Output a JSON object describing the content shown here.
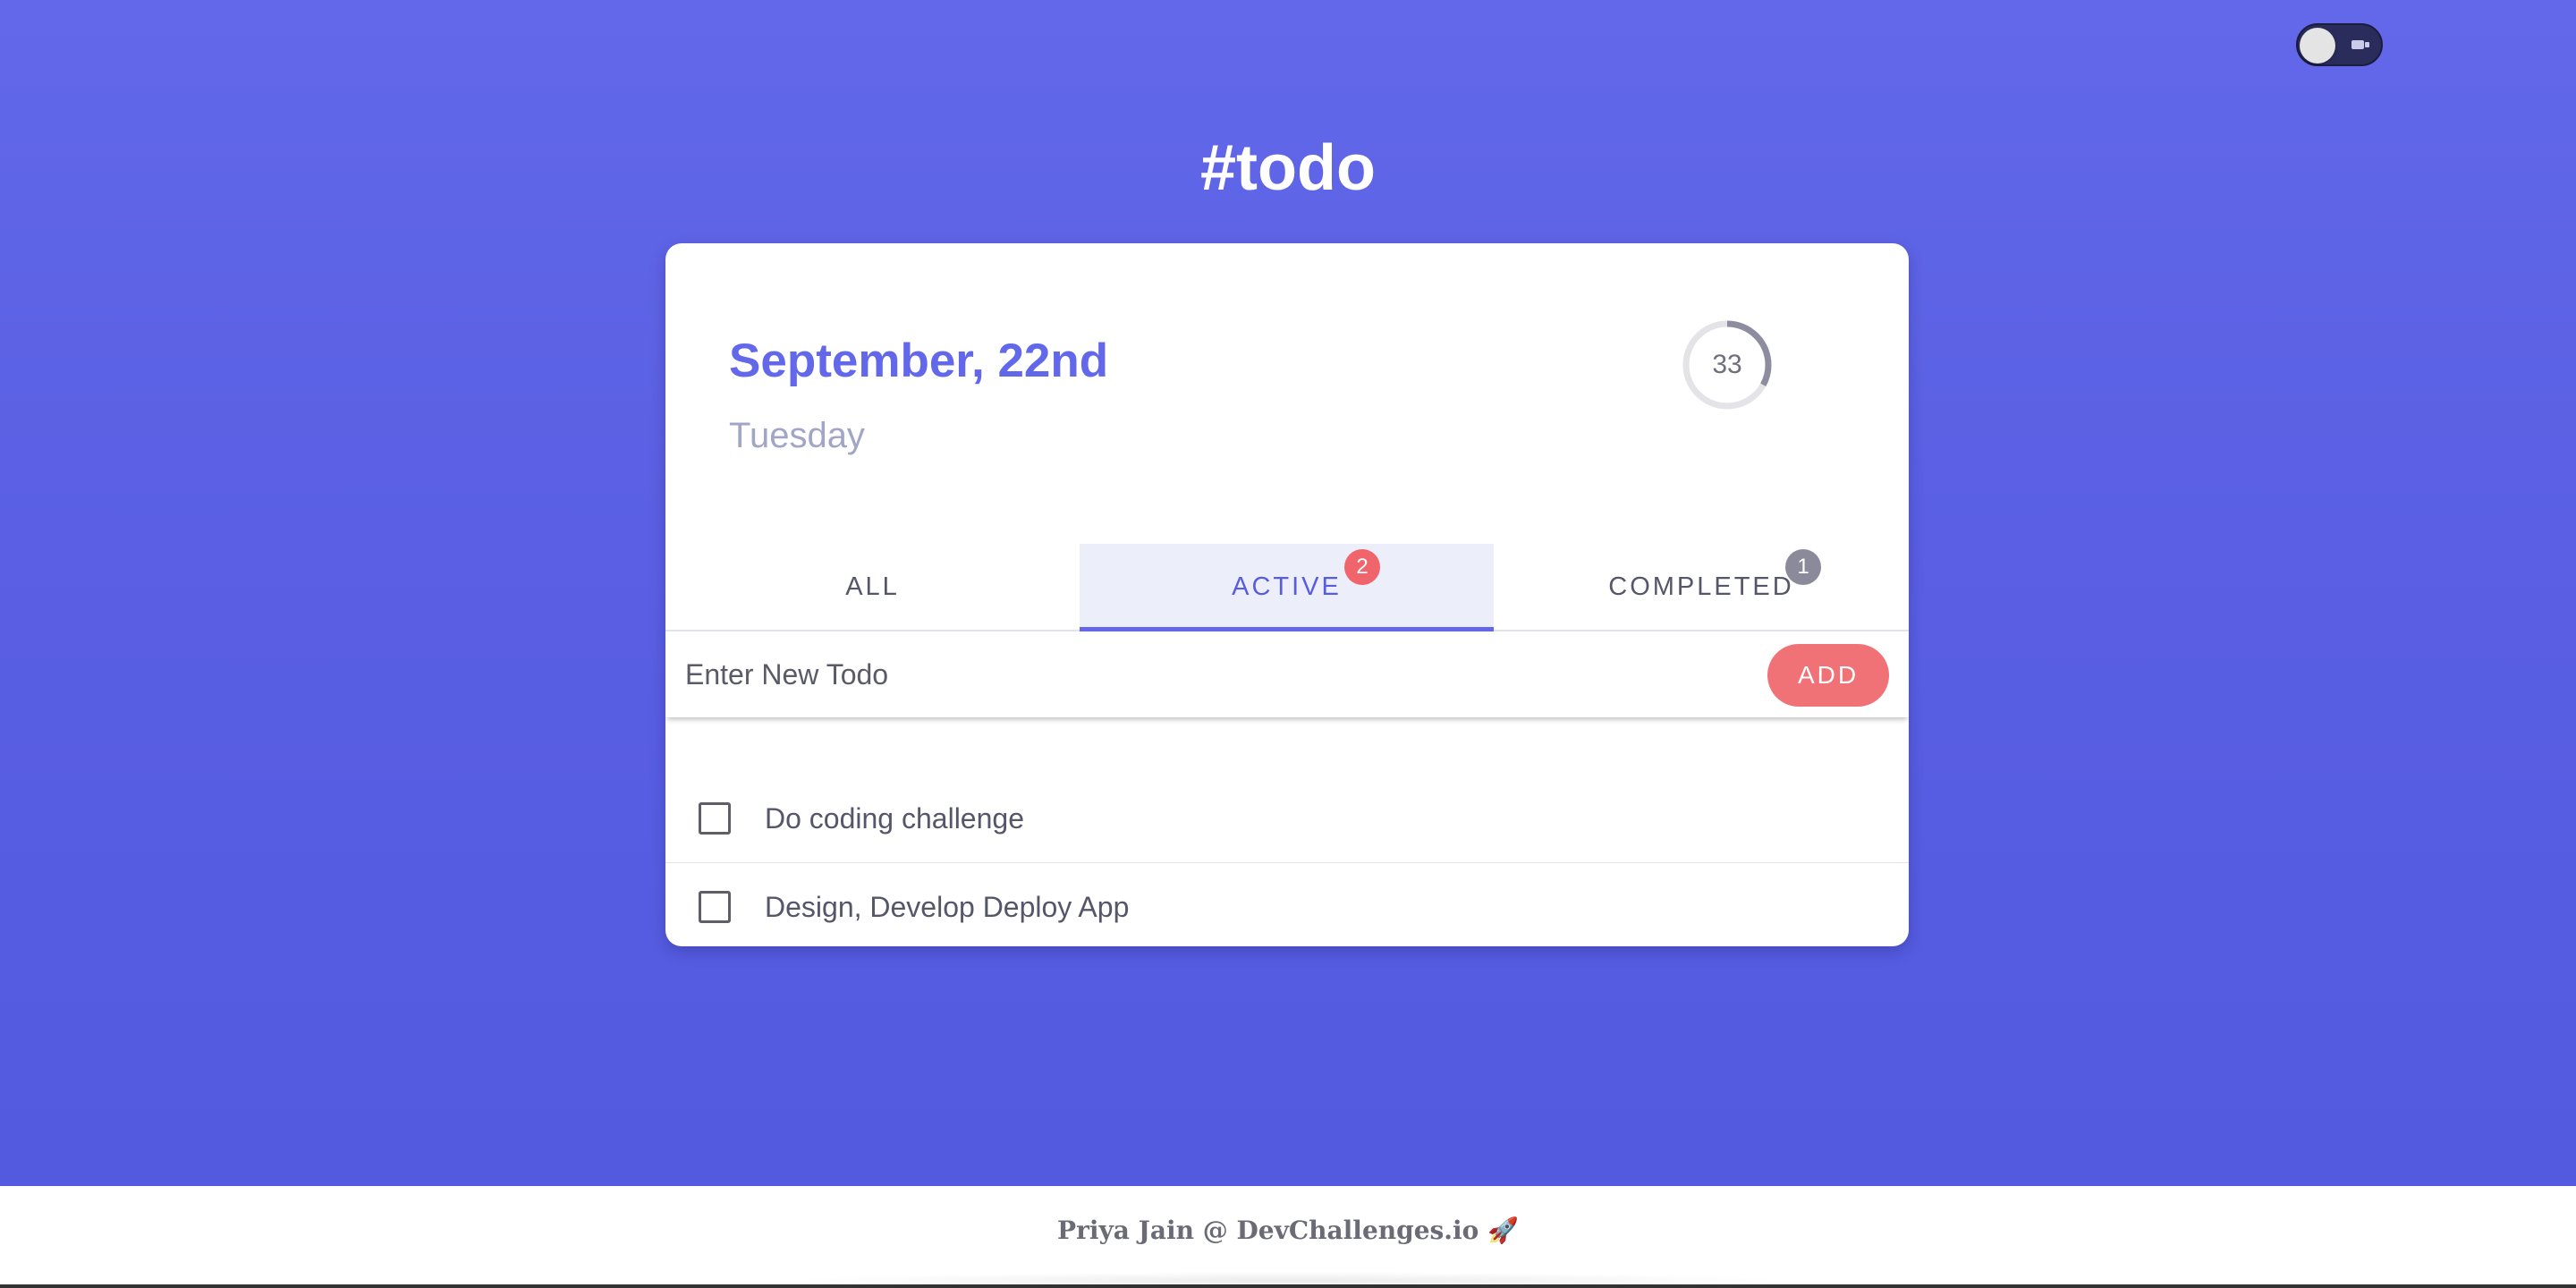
{
  "app": {
    "title": "#todo"
  },
  "theme_toggle": {
    "icon": "moon-icon"
  },
  "header": {
    "date": "September, 22nd",
    "day": "Tuesday",
    "progress": {
      "value": 33,
      "label": "33"
    }
  },
  "tabs": [
    {
      "label": "ALL",
      "badge": ""
    },
    {
      "label": "ACTIVE",
      "badge": "2"
    },
    {
      "label": "COMPLETED",
      "badge": "1"
    }
  ],
  "new_todo": {
    "placeholder": "Enter New Todo",
    "value": "",
    "add_label": "ADD"
  },
  "todos": [
    {
      "text": "Do coding challenge",
      "done": false
    },
    {
      "text": "Design, Develop Deploy App",
      "done": false
    }
  ],
  "footer": {
    "text": "Priya Jain @ DevChallenges.io 🚀"
  },
  "colors": {
    "accent": "#6268e9",
    "add_button": "#f07277",
    "badge_active": "#f0646b",
    "badge_completed": "#8b8a9a"
  }
}
